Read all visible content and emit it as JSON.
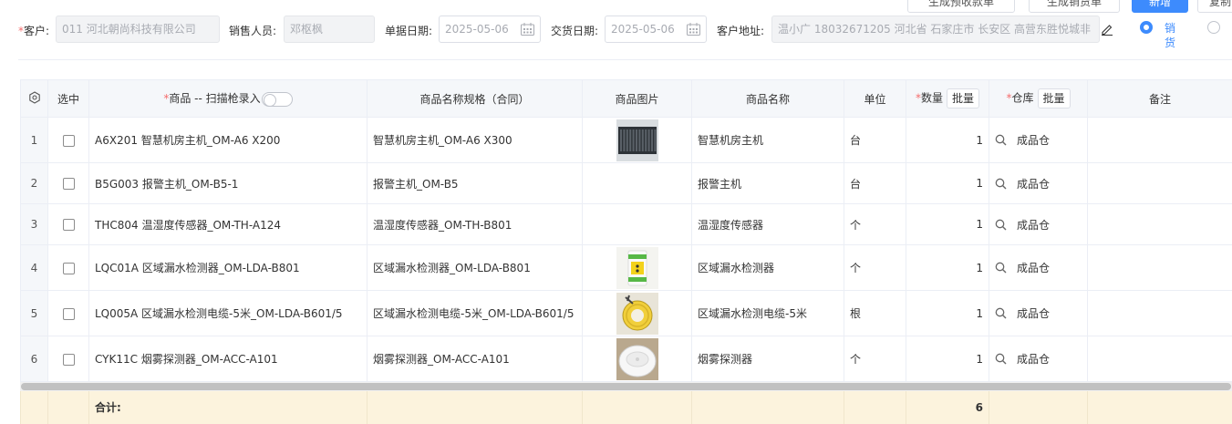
{
  "top_actions": {
    "gen_receipt_label": "生成预收款单",
    "gen_sale_label": "生成销货单",
    "add_label": "新增",
    "copy_label": "复制"
  },
  "form": {
    "customer_label": "客户:",
    "customer_value": "011 河北朝尚科技有限公司",
    "salesperson_label": "销售人员:",
    "salesperson_value": "邓枢枫",
    "doc_date_label": "单据日期:",
    "doc_date_value": "2025-05-06",
    "delivery_date_label": "交货日期:",
    "delivery_date_value": "2025-05-06",
    "address_label": "客户地址:",
    "address_value": "温小广 18032671205 河北省 石家庄市 长安区 高营东胜悦城非",
    "radio_sale_label": "销货"
  },
  "table": {
    "headers": {
      "select": "选中",
      "product": "商品 -- 扫描枪录入",
      "spec": "商品名称规格（合同）",
      "image": "商品图片",
      "name": "商品名称",
      "unit": "单位",
      "qty": "数量",
      "warehouse": "仓库",
      "remark": "备注",
      "batch": "批量"
    },
    "rows": [
      {
        "no": "1",
        "product": "A6X201 智慧机房主机_OM-A6 X200",
        "spec": "智慧机房主机_OM-A6 X300",
        "name": "智慧机房主机",
        "unit": "台",
        "qty": "1",
        "warehouse": "成品仓",
        "image": "server-host"
      },
      {
        "no": "2",
        "product": "B5G003 报警主机_OM-B5-1",
        "spec": "报警主机_OM-B5",
        "name": "报警主机",
        "unit": "台",
        "qty": "1",
        "warehouse": "成品仓",
        "image": ""
      },
      {
        "no": "3",
        "product": "THC804 温湿度传感器_OM-TH-A124",
        "spec": "温湿度传感器_OM-TH-B801",
        "name": "温湿度传感器",
        "unit": "个",
        "qty": "1",
        "warehouse": "成品仓",
        "image": ""
      },
      {
        "no": "4",
        "product": "LQC01A 区域漏水检测器_OM-LDA-B801",
        "spec": "区域漏水检测器_OM-LDA-B801",
        "name": "区域漏水检测器",
        "unit": "个",
        "qty": "1",
        "warehouse": "成品仓",
        "image": "leak-detector"
      },
      {
        "no": "5",
        "product": "LQ005A 区域漏水检测电缆-5米_OM-LDA-B601/5",
        "spec": "区域漏水检测电缆-5米_OM-LDA-B601/5",
        "name": "区域漏水检测电缆-5米",
        "unit": "根",
        "qty": "1",
        "warehouse": "成品仓",
        "image": "cable-reel"
      },
      {
        "no": "6",
        "product": "CYK11C 烟雾探测器_OM-ACC-A101",
        "spec": "烟雾探测器_OM-ACC-A101",
        "name": "烟雾探测器",
        "unit": "个",
        "qty": "1",
        "warehouse": "成品仓",
        "image": "smoke-detector"
      }
    ],
    "footer": {
      "total_label": "合计:",
      "total_qty": "6"
    }
  },
  "colors": {
    "primary": "#3d8bfd",
    "required": "#f56c6c",
    "footer_bg": "#fcf3dd"
  }
}
